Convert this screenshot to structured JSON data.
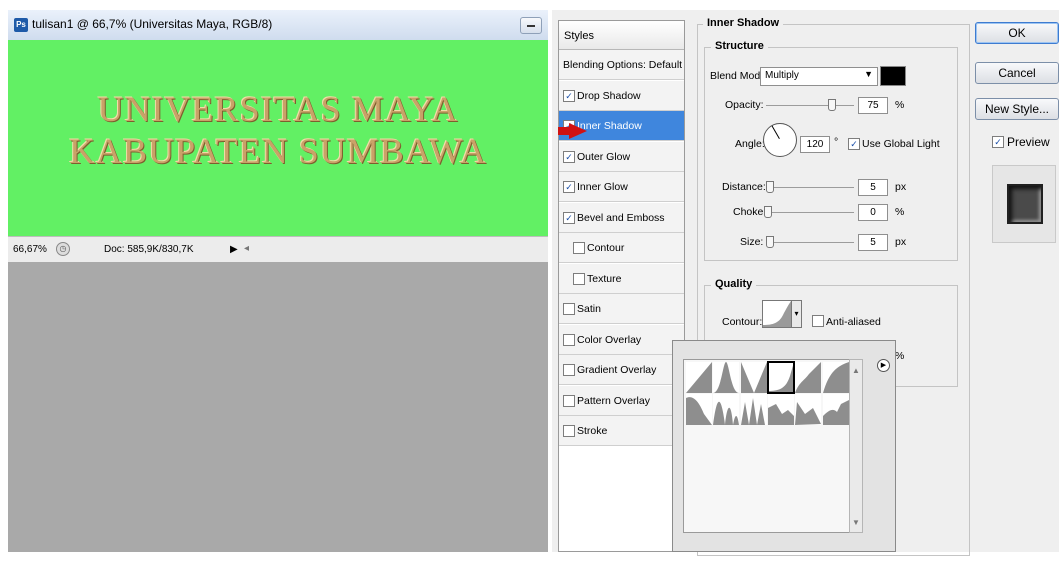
{
  "document": {
    "title": "tulisan1 @ 66,7% (Universitas Maya, RGB/8)",
    "app_icon": "ps-icon",
    "app_icon_text": "Ps",
    "canvas_line1": "UNIVERSITAS MAYA",
    "canvas_line2": "KABUPATEN SUMBAWA",
    "canvas_color": "#62f064",
    "text_color": "#c9a268",
    "zoom": "66,67%",
    "doc_size": "Doc: 585,9K/830,7K"
  },
  "styles_panel": {
    "header": "Styles",
    "items": [
      {
        "label": "Blending Options: Default",
        "checkbox": null,
        "selected": false
      },
      {
        "label": "Drop Shadow",
        "checkbox": true,
        "selected": false
      },
      {
        "label": "Inner Shadow",
        "checkbox": true,
        "selected": true
      },
      {
        "label": "Outer Glow",
        "checkbox": true,
        "selected": false
      },
      {
        "label": "Inner Glow",
        "checkbox": true,
        "selected": false
      },
      {
        "label": "Bevel and Emboss",
        "checkbox": true,
        "selected": false
      },
      {
        "label": "Contour",
        "checkbox": false,
        "selected": false,
        "indent": true
      },
      {
        "label": "Texture",
        "checkbox": false,
        "selected": false,
        "indent": true
      },
      {
        "label": "Satin",
        "checkbox": false,
        "selected": false
      },
      {
        "label": "Color Overlay",
        "checkbox": false,
        "selected": false
      },
      {
        "label": "Gradient Overlay",
        "checkbox": false,
        "selected": false
      },
      {
        "label": "Pattern Overlay",
        "checkbox": false,
        "selected": false
      },
      {
        "label": "Stroke",
        "checkbox": false,
        "selected": false
      }
    ]
  },
  "inner_shadow": {
    "title": "Inner Shadow",
    "structure": {
      "title": "Structure",
      "blend_mode_label": "Blend Mode:",
      "blend_mode_value": "Multiply",
      "shadow_color": "#000000",
      "opacity_label": "Opacity:",
      "opacity_value": "75",
      "opacity_unit": "%",
      "opacity_fraction": 0.75,
      "angle_label": "Angle:",
      "angle_value": "120",
      "angle_unit": "°",
      "use_global_light_label": "Use Global Light",
      "use_global_light": true,
      "distance_label": "Distance:",
      "distance_value": "5",
      "distance_unit": "px",
      "choke_label": "Choke:",
      "choke_value": "0",
      "choke_unit": "%",
      "size_label": "Size:",
      "size_value": "5",
      "size_unit": "px"
    },
    "quality": {
      "title": "Quality",
      "contour_label": "Contour:",
      "anti_aliased_label": "Anti-aliased",
      "anti_aliased": false,
      "noise_unit": "%"
    }
  },
  "buttons": {
    "ok": "OK",
    "cancel": "Cancel",
    "new_style": "New Style...",
    "preview_label": "Preview",
    "preview_checked": true
  }
}
